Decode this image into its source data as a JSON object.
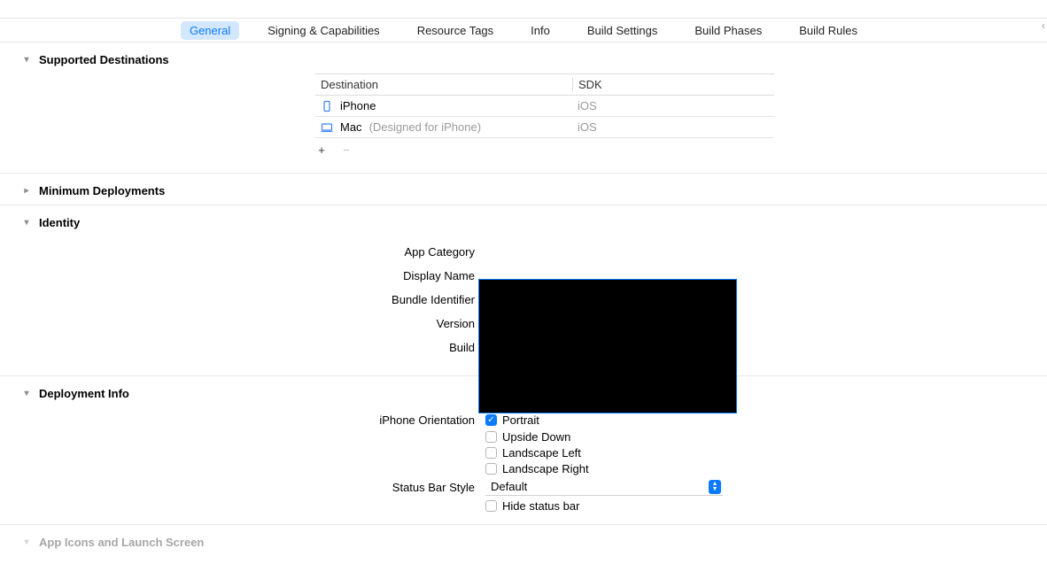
{
  "tabs": {
    "general": "General",
    "signing": "Signing & Capabilities",
    "resourceTags": "Resource Tags",
    "info": "Info",
    "buildSettings": "Build Settings",
    "buildPhases": "Build Phases",
    "buildRules": "Build Rules",
    "selected": "general"
  },
  "sections": {
    "supportedDestinations": {
      "title": "Supported Destinations",
      "headers": {
        "destination": "Destination",
        "sdk": "SDK"
      },
      "rows": [
        {
          "label": "iPhone",
          "aux": "",
          "sdk": "iOS",
          "icon": "iphone"
        },
        {
          "label": "Mac",
          "aux": "(Designed for iPhone)",
          "sdk": "iOS",
          "icon": "mac"
        }
      ],
      "addLabel": "+",
      "removeLabel": "−"
    },
    "minimumDeployments": {
      "title": "Minimum Deployments"
    },
    "identity": {
      "title": "Identity",
      "labels": {
        "appCategory": "App Category",
        "displayName": "Display Name",
        "bundleIdentifier": "Bundle Identifier",
        "version": "Version",
        "build": "Build"
      }
    },
    "deploymentInfo": {
      "title": "Deployment Info",
      "orientationLabel": "iPhone Orientation",
      "orientations": {
        "portrait": {
          "label": "Portrait",
          "checked": true
        },
        "upsideDown": {
          "label": "Upside Down",
          "checked": false
        },
        "landscapeLeft": {
          "label": "Landscape Left",
          "checked": false
        },
        "landscapeRight": {
          "label": "Landscape Right",
          "checked": false
        }
      },
      "statusBarStyleLabel": "Status Bar Style",
      "statusBarStyleValue": "Default",
      "hideStatusBar": {
        "label": "Hide status bar",
        "checked": false
      }
    },
    "appIcons": {
      "title": "App Icons and Launch Screen"
    }
  }
}
